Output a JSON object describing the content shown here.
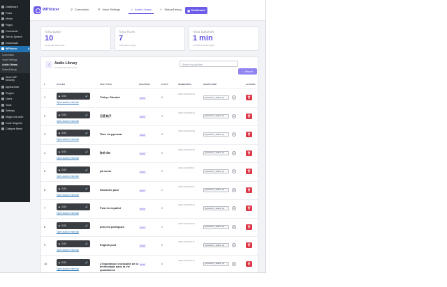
{
  "wp_sidebar": {
    "items": [
      {
        "label": "Dashboard"
      },
      {
        "label": "Posts"
      },
      {
        "label": "Media"
      },
      {
        "label": "Pages"
      },
      {
        "label": "Comments"
      },
      {
        "label": "Text to Speech"
      },
      {
        "label": "Downloads"
      },
      {
        "label": "WPVoicer"
      }
    ],
    "submenu": [
      "Connection",
      "Voice Settings",
      "Audio Library",
      "Status/Debug"
    ],
    "items_after": [
      {
        "label": "Smart WP Security"
      },
      {
        "label": "Appearance"
      },
      {
        "label": "Plugins"
      },
      {
        "label": "Users"
      },
      {
        "label": "Tools"
      },
      {
        "label": "Settings"
      },
      {
        "label": "Magic Link Auth"
      },
      {
        "label": "Code Snippets"
      },
      {
        "label": "Collapse Menu"
      }
    ]
  },
  "topnav": {
    "brand": "WPVoicer",
    "tabs": [
      "Connection",
      "Voice Settings",
      "Audio Library",
      "Status/Debug"
    ],
    "dashboard_label": "Dashboard"
  },
  "stats": [
    {
      "label": "Total Audio",
      "value": "10",
      "sub": "Generated audio files"
    },
    {
      "label": "Total Plays",
      "value": "7",
      "sub": "Total listener plays"
    },
    {
      "label": "Total Duration",
      "value": "1 min",
      "sub": "Combined audio length"
    }
  ],
  "library": {
    "title": "Audio Library",
    "subtitle": "10 matching audio posts",
    "search_placeholder": "Search by post title",
    "search_label": "Search",
    "columns": [
      "#",
      "Player",
      "Post Title",
      "Duration",
      "Plays",
      "Generated",
      "Shortcode",
      "Actions"
    ],
    "open_label": "Open audio in new tab",
    "rows": [
      {
        "num": "1",
        "time": "0:00",
        "title": "Türkçe Gönderi",
        "duration": "00:03",
        "plays": "0",
        "generated": "2025-12-08 09:45",
        "shortcode": "[wpvoicer_audio po"
      },
      {
        "num": "2",
        "time": "0:00",
        "title": "日语 帖子",
        "duration": "00:04",
        "plays": "0",
        "generated": "2025-12-08 09:42",
        "shortcode": "[wpvoicer_audio po"
      },
      {
        "num": "3",
        "time": "0:00",
        "title": "Пост на русском",
        "duration": "00:03",
        "plays": "0",
        "generated": "2025-12-08 09:38",
        "shortcode": "[wpvoicer_audio po"
      },
      {
        "num": "4",
        "time": "0:00",
        "title": "हिन्दी पोस्ट",
        "duration": "00:03",
        "plays": "0",
        "generated": "2025-12-08 09:35",
        "shortcode": "[wpvoicer_audio po"
      },
      {
        "num": "5",
        "time": "0:00",
        "title": "på norsk",
        "duration": "00:03",
        "plays": "0",
        "generated": "2025-12-08 09:31",
        "shortcode": "[wpvoicer_audio po"
      },
      {
        "num": "6",
        "time": "0:00",
        "title": "Deutsche post",
        "duration": "00:07",
        "plays": "1",
        "generated": "2025-12-08 09:27",
        "shortcode": "[wpvoicer_audio po"
      },
      {
        "num": "7",
        "time": "0:00",
        "title": "Post en español",
        "duration": "00:03",
        "plays": "0",
        "generated": "2025-12-08 09:24",
        "shortcode": "[wpvoicer_audio po"
      },
      {
        "num": "8",
        "time": "0:00",
        "title": "post em portugues",
        "duration": "00:04",
        "plays": "1",
        "generated": "2025-12-08 09:20",
        "shortcode": "[wpvoicer_audio po"
      },
      {
        "num": "9",
        "time": "0:00",
        "title": "English post",
        "duration": "00:02",
        "plays": "0",
        "generated": "2025-12-08 09:17",
        "shortcode": "[wpvoicer_audio po"
      },
      {
        "num": "10",
        "time": "0:00",
        "title": "L'importance croissante de la technologie dans la vie quotidienne",
        "duration": "00:30",
        "plays": "0",
        "generated": "2025-12-08 09:12",
        "shortcode": "[wpvoicer_audio po"
      }
    ]
  },
  "colors": {
    "accent": "#6d5ce8",
    "sidebar_bg": "#1d2327",
    "active_menu": "#2271b1",
    "delete": "#dc3545"
  }
}
